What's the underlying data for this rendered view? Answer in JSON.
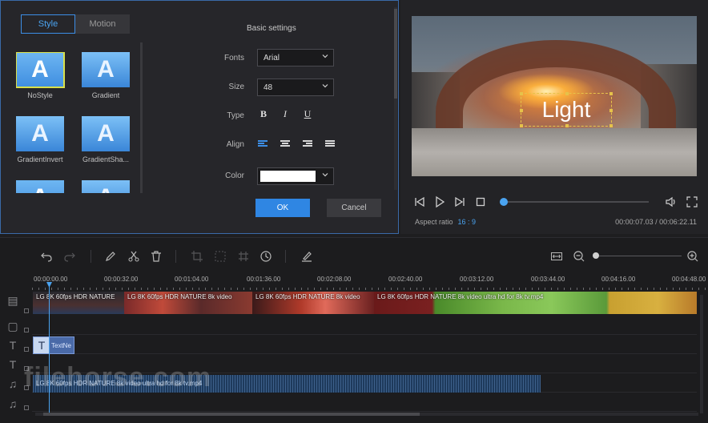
{
  "style_panel": {
    "tabs": [
      {
        "label": "Style",
        "active": true
      },
      {
        "label": "Motion",
        "active": false
      }
    ],
    "styles": [
      {
        "label": "NoStyle",
        "selected": true
      },
      {
        "label": "Gradient",
        "selected": false
      },
      {
        "label": "GradientInvert",
        "selected": false
      },
      {
        "label": "GradientSha...",
        "selected": false
      },
      {
        "label": "",
        "selected": false
      },
      {
        "label": "",
        "selected": false
      }
    ],
    "thumb_glyph": "A",
    "settings_title": "Basic settings",
    "fonts_label": "Fonts",
    "fonts_value": "Arial",
    "size_label": "Size",
    "size_value": "48",
    "type_label": "Type",
    "type_bold": "B",
    "type_italic": "I",
    "type_underline": "U",
    "align_label": "Align",
    "align_options": [
      "align-left-icon",
      "align-center-icon",
      "align-right-icon",
      "align-justify-icon"
    ],
    "align_active": "align-left-icon",
    "color_label": "Color",
    "color_value": "#ffffff",
    "ok_label": "OK",
    "cancel_label": "Cancel"
  },
  "preview": {
    "caption": "Light",
    "aspect_label": "Aspect ratio",
    "aspect_value": "16 : 9",
    "timecode": "00:00:07.03 / 00:06:22.11",
    "progress": 0.0,
    "accent": "#4aa3f0"
  },
  "timeline": {
    "ruler_labels": [
      "00:00:00.00",
      "00:00:32.00",
      "00:01:04.00",
      "00:01:36.00",
      "00:02:08.00",
      "00:02:40.00",
      "00:03:12.00",
      "00:03:44.00",
      "00:04:16.00",
      "00:04:48.00"
    ],
    "video_clips": [
      "LG 8K 60fps HDR NATURE",
      "LG 8K 60fps HDR NATURE 8k video",
      "LG 8K 60fps HDR NATURE 8k video",
      "LG 8K 60fps HDR NATURE 8k video ultra hd for 8k tv.mp4"
    ],
    "text_clip": "TextNe",
    "text_clip_glyph": "T",
    "audio_clip": "LG 8K 60fps HDR NATURE 8k video ultra hd for 8k tv.mp4",
    "zoom_level": 0.0
  },
  "watermark": "filehorse.com"
}
